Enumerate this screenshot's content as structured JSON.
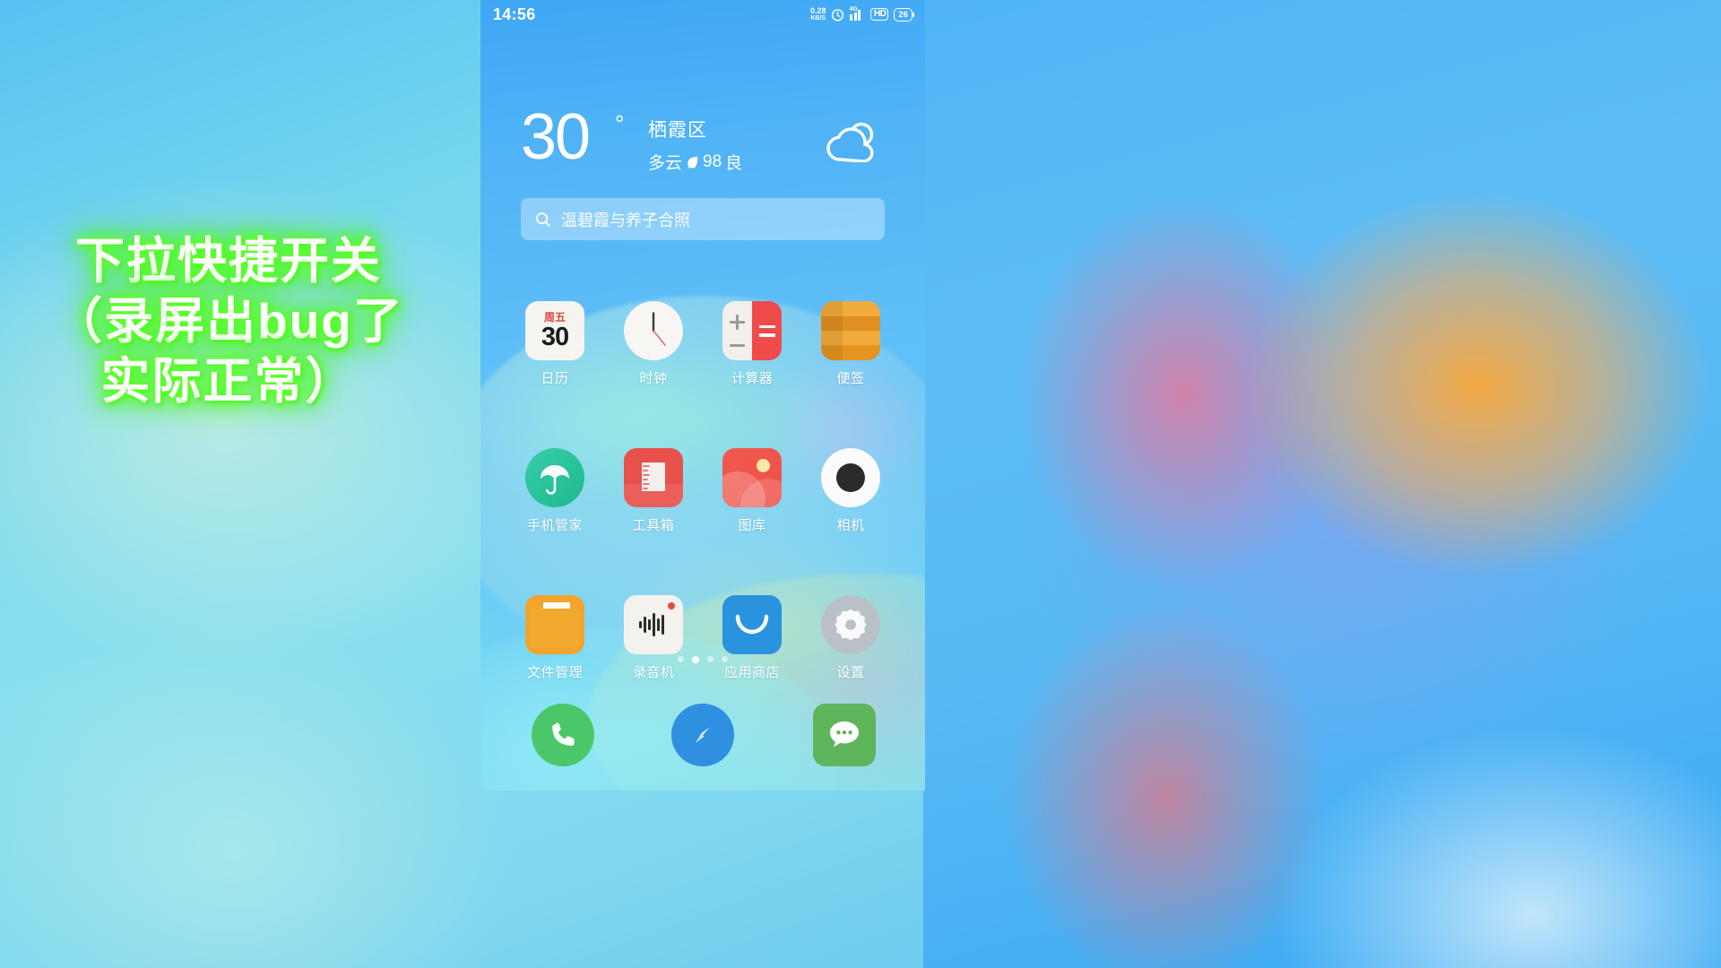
{
  "statusbar": {
    "time": "14:56",
    "net_speed_value": "0.28",
    "net_speed_unit": "KB/S",
    "alarm_icon": "alarm-clock-icon",
    "network_type": "4G",
    "hd_label": "HD",
    "battery_level": "26"
  },
  "weather": {
    "temperature": "30",
    "degree_symbol": "°",
    "city": "栖霞区",
    "condition": "多云",
    "aqi_value": "98",
    "aqi_label": "良",
    "leaf_icon": "leaf-icon",
    "weather_icon": "partly-cloudy-icon"
  },
  "search": {
    "icon": "search-icon",
    "query": "温碧霞与养子合照"
  },
  "apps": {
    "row1": [
      {
        "label": "日历",
        "icon": "calendar-icon",
        "weekday": "周五",
        "day": "30"
      },
      {
        "label": "时钟",
        "icon": "clock-icon"
      },
      {
        "label": "计算器",
        "icon": "calculator-icon"
      },
      {
        "label": "便签",
        "icon": "notes-icon"
      }
    ],
    "row2": [
      {
        "label": "手机管家",
        "icon": "phone-manager-umbrella-icon"
      },
      {
        "label": "工具箱",
        "icon": "toolbox-ruler-icon"
      },
      {
        "label": "图库",
        "icon": "gallery-icon"
      },
      {
        "label": "相机",
        "icon": "camera-icon"
      }
    ],
    "row3": [
      {
        "label": "文件管理",
        "icon": "file-manager-folder-icon"
      },
      {
        "label": "录音机",
        "icon": "recorder-waveform-icon"
      },
      {
        "label": "应用商店",
        "icon": "app-store-bag-icon"
      },
      {
        "label": "设置",
        "icon": "settings-gear-icon"
      }
    ]
  },
  "pager": {
    "total": 4,
    "active_index": 1
  },
  "dock": [
    {
      "name": "phone-dock-icon",
      "icon": "phone-handset-icon"
    },
    {
      "name": "browser-dock-icon",
      "icon": "compass-icon"
    },
    {
      "name": "messages-dock-icon",
      "icon": "chat-bubble-icon"
    }
  ],
  "caption": {
    "line1": "下拉快捷开关",
    "line2": "（录屏出bug了",
    "line3": "实际正常）",
    "glow_color": "#5cff2b",
    "text_color": "#ffffff"
  }
}
